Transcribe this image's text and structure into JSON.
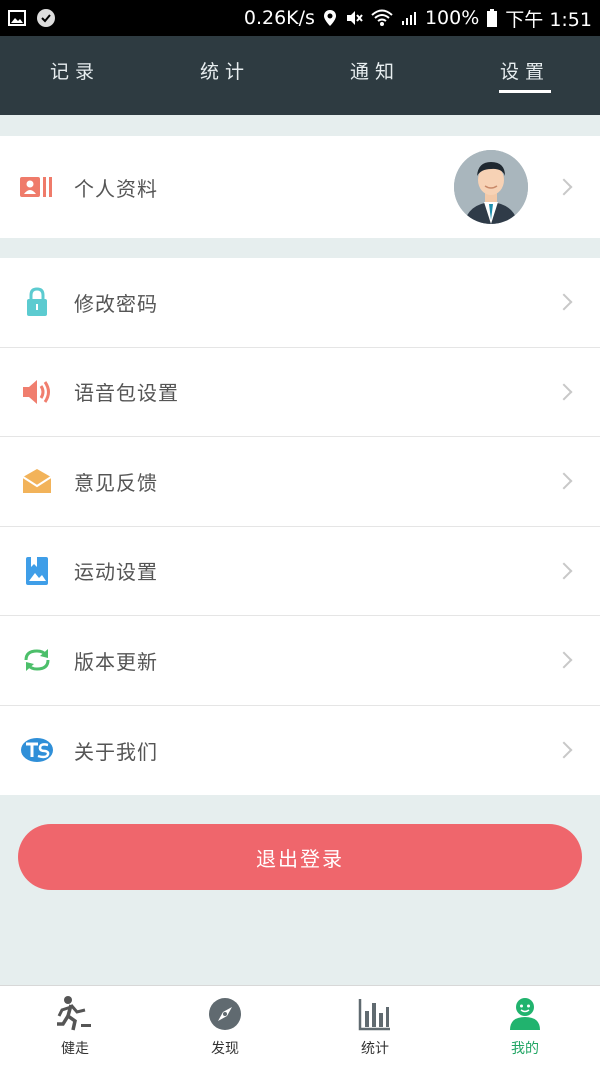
{
  "status_bar": {
    "speed": "0.26K/s",
    "battery": "100%",
    "time": "下午 1:51"
  },
  "top_tabs": [
    {
      "label": "记录"
    },
    {
      "label": "统计"
    },
    {
      "label": "通知"
    },
    {
      "label": "设置",
      "active": true
    }
  ],
  "profile": {
    "label": "个人资料",
    "icon": "id-card-icon"
  },
  "menu": [
    {
      "label": "修改密码",
      "icon": "lock-icon"
    },
    {
      "label": "语音包设置",
      "icon": "speaker-icon"
    },
    {
      "label": "意见反馈",
      "icon": "envelope-icon"
    },
    {
      "label": "运动设置",
      "icon": "bookmark-image-icon"
    },
    {
      "label": "版本更新",
      "icon": "refresh-icon"
    },
    {
      "label": "关于我们",
      "icon": "logo-icon"
    }
  ],
  "logout_label": "退出登录",
  "bottom_nav": [
    {
      "label": "健走",
      "icon": "runner-icon"
    },
    {
      "label": "发现",
      "icon": "compass-icon"
    },
    {
      "label": "统计",
      "icon": "bar-chart-icon"
    },
    {
      "label": "我的",
      "icon": "user-icon",
      "active": true
    }
  ],
  "colors": {
    "header_bg": "#2e3b41",
    "logout_bg": "#ef666c",
    "active_green": "#21a564",
    "page_bg": "#e6eeee"
  }
}
